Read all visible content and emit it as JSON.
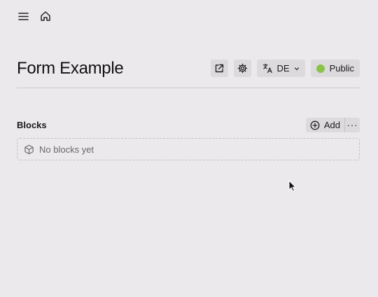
{
  "topbar": {
    "menu_icon": "hamburger-menu-icon",
    "home_icon": "home-icon"
  },
  "header": {
    "title": "Form Example",
    "open_icon": "external-link-icon",
    "settings_icon": "gear-icon",
    "language": {
      "icon": "translate-icon",
      "value": "DE",
      "chevron": "chevron-down-icon"
    },
    "status": {
      "label": "Public",
      "color": "#8bc34a"
    }
  },
  "blocks": {
    "title": "Blocks",
    "add_label": "Add",
    "more_label": "···",
    "empty_text": "No blocks yet",
    "empty_icon": "cube-icon"
  }
}
